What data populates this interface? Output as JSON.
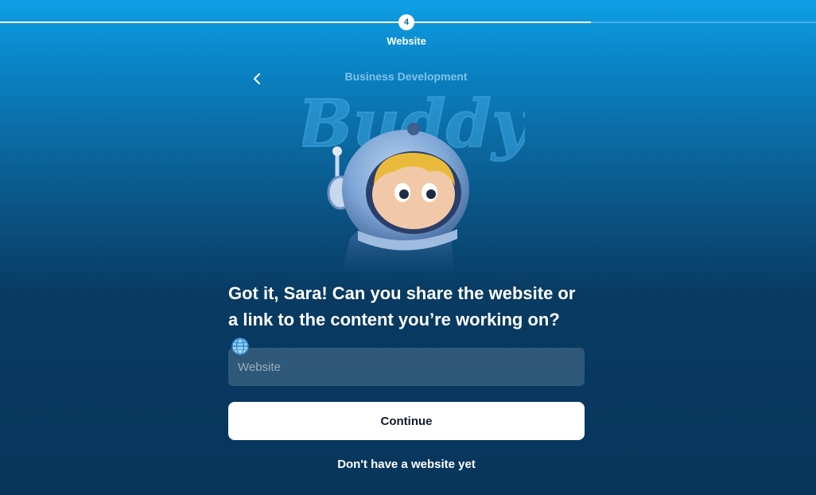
{
  "progress": {
    "step_number": "4",
    "step_label": "Website",
    "fraction_complete": 0.724
  },
  "navigation": {
    "back_icon": "chevron-left-icon"
  },
  "brand": {
    "subtitle": "Business Development",
    "wordmark": "Buddy"
  },
  "prompt": {
    "question": "Got it, Sara! Can you share the website or a link to the content you’re working on?",
    "emoji_icon": "globe-icon"
  },
  "form": {
    "website_placeholder": "Website",
    "website_value": "",
    "continue_label": "Continue",
    "no_website_label": "Don't have a website yet"
  },
  "colors": {
    "accent_top": "#0e9fe6",
    "background_bottom": "#07365c",
    "button_bg": "#ffffff"
  }
}
